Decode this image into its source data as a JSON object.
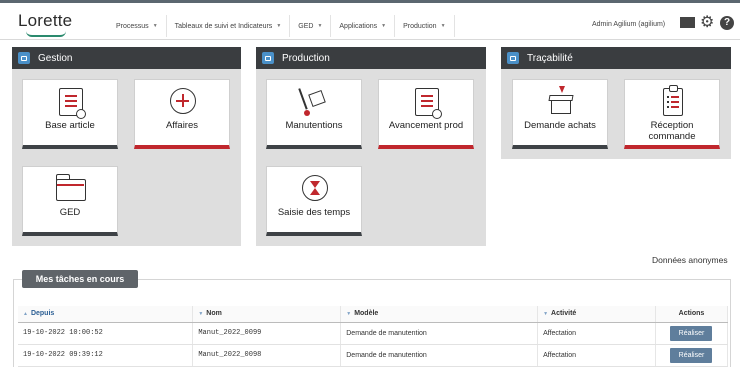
{
  "header": {
    "logo": "Lorette",
    "nav": [
      "Processus",
      "Tableaux de suivi et Indicateurs",
      "GED",
      "Applications",
      "Production"
    ],
    "user": "Admin Agilium (agilium)"
  },
  "panels": {
    "gestion": {
      "title": "Gestion",
      "tiles": [
        "Base article",
        "Affaires",
        "GED"
      ]
    },
    "production": {
      "title": "Production",
      "tiles": [
        "Manutentions",
        "Avancement prod",
        "Saisie des temps"
      ]
    },
    "tracabilite": {
      "title": "Traçabilité",
      "tiles": [
        "Demande achats",
        "Réception commande"
      ]
    }
  },
  "anonymous_label": "Données anonymes",
  "tasks": {
    "tab_label": "Mes tâches en cours",
    "columns": [
      "Depuis",
      "Nom",
      "Modèle",
      "Activité",
      "Actions"
    ],
    "rows": [
      {
        "depuis": "19-10-2022 10:00:52",
        "nom": "Manut_2022_0099",
        "modele": "Demande de manutention",
        "activite": "Affectation",
        "action": "Réaliser"
      },
      {
        "depuis": "19-10-2022 09:39:12",
        "nom": "Manut_2022_0098",
        "modele": "Demande de manutention",
        "activite": "Affectation",
        "action": "Réaliser"
      }
    ]
  },
  "colors": {
    "panel_header": "#3a3d40",
    "panel_icon": "#4a90c8",
    "accent_red": "#c0272d",
    "button": "#5f7e9c"
  }
}
